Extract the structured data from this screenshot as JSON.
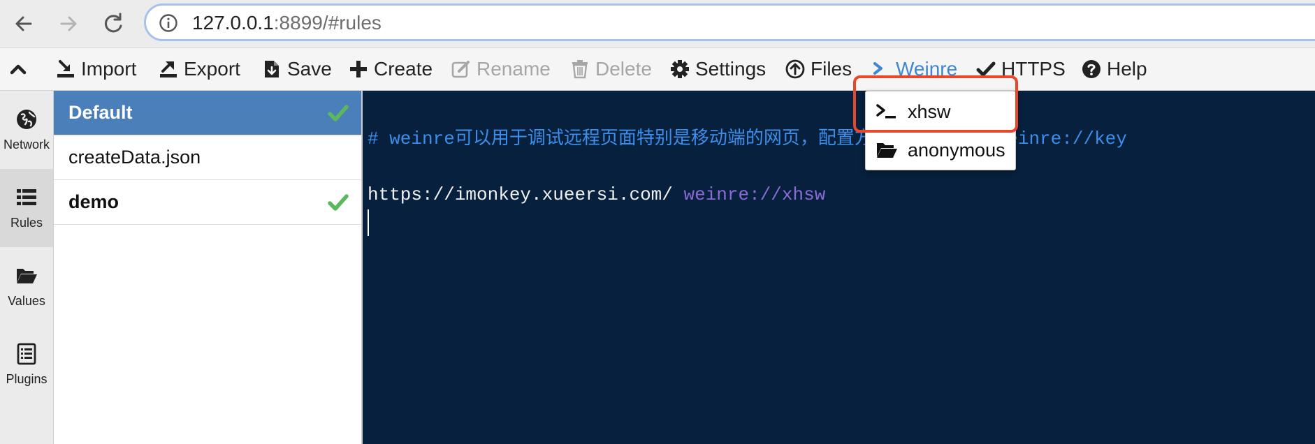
{
  "browser": {
    "url_host": "127.0.0.1",
    "url_rest": ":8899/#rules"
  },
  "toolbar": {
    "import": "Import",
    "export": "Export",
    "save": "Save",
    "create": "Create",
    "rename": "Rename",
    "delete": "Delete",
    "settings": "Settings",
    "files": "Files",
    "weinre": "Weinre",
    "https": "HTTPS",
    "help": "Help"
  },
  "leftnav": {
    "items": [
      {
        "label": "Network",
        "icon": "globe-icon"
      },
      {
        "label": "Rules",
        "icon": "list-icon",
        "active": true
      },
      {
        "label": "Values",
        "icon": "folder-open-icon"
      },
      {
        "label": "Plugins",
        "icon": "document-list-icon"
      }
    ]
  },
  "rules": [
    {
      "name": "Default",
      "selected": true,
      "checked": true
    },
    {
      "name": "createData.json",
      "selected": false,
      "checked": false
    },
    {
      "name": "demo",
      "selected": false,
      "checked": true
    }
  ],
  "editor": {
    "comment_line": "# weinre可以用于调试远程页面特别是移动端的网页，配置方式：pattern weinre://key",
    "rule_url": "https://imonkey.xueersi.com/",
    "rule_protocol": "weinre://xhsw"
  },
  "weinre_menu": {
    "items": [
      "xhsw",
      "anonymous"
    ]
  },
  "colors": {
    "selected_rule_bg": "#4a7fba",
    "editor_bg": "#07203d",
    "check_green": "#5cb85c",
    "highlight_border": "#e8472a",
    "weinre_link": "#3f87d4"
  }
}
